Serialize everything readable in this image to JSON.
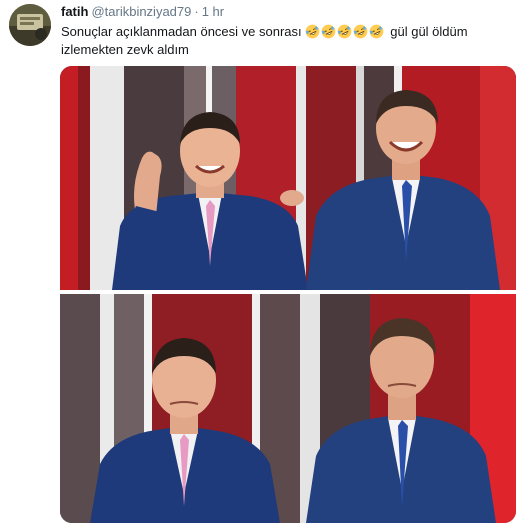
{
  "tweet": {
    "author_name": "fatih",
    "handle": "@tarikbinziyad79",
    "separator": "·",
    "time": "1 hr",
    "text_before_emoji": "Sonuçlar açıklanmadan öncesi ve sonrası",
    "emoji_icon": "rolling-on-floor-laughing-icon",
    "emoji_count": 5,
    "text_after_emoji": "gül gül öldüm izlemekten zevk aldım"
  },
  "colors": {
    "text": "#14171a",
    "secondary": "#657786",
    "emoji_face": "#ffcc4d",
    "suit": "#1f3a7a",
    "tie_pink": "#e79ac2",
    "tie_blue": "#2a4fa8",
    "studio_red": "#b01a22"
  }
}
